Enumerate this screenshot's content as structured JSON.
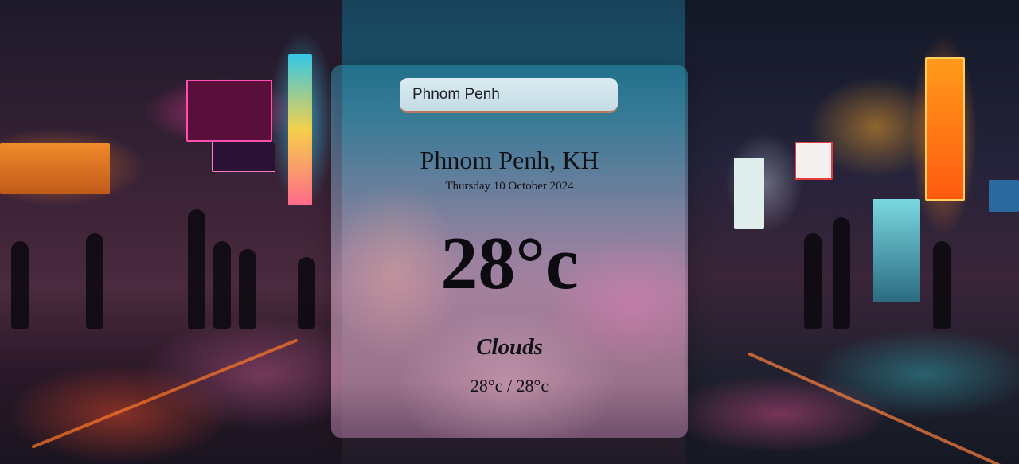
{
  "search": {
    "value": "Phnom Penh"
  },
  "weather": {
    "location": "Phnom Penh, KH",
    "date": "Thursday 10 October 2024",
    "temperature": "28°c",
    "condition": "Clouds",
    "hi_lo": "28°c / 28°c"
  }
}
